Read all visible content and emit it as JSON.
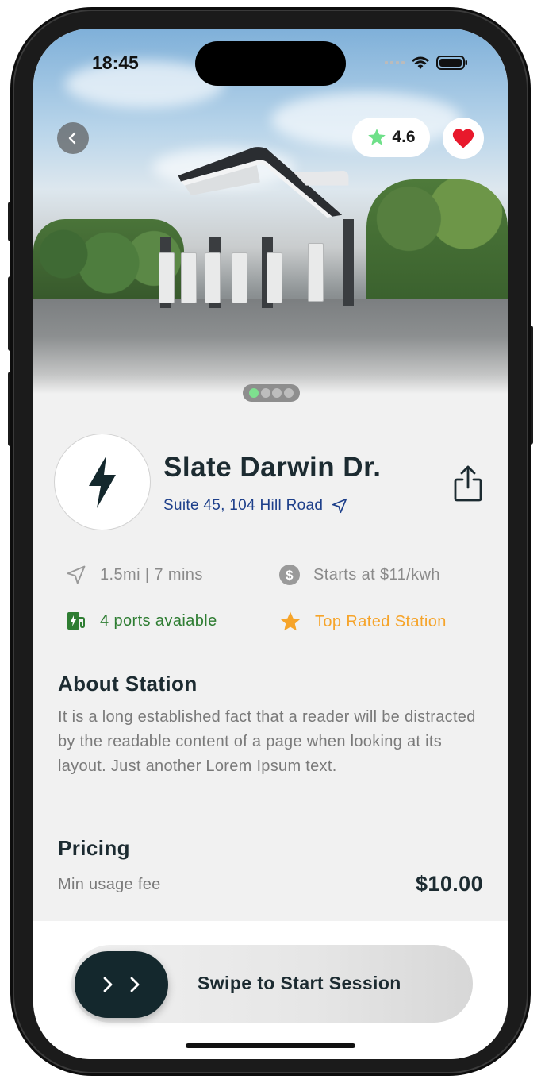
{
  "status_bar": {
    "time": "18:45"
  },
  "hero": {
    "rating": "4.6",
    "carousel": {
      "count": 4,
      "active": 0
    }
  },
  "station": {
    "name": "Slate Darwin Dr.",
    "address": "Suite 45, 104 Hill Road"
  },
  "info": {
    "distance": "1.5mi | 7 mins",
    "price": "Starts at $11/kwh",
    "ports": "4 ports avaiable",
    "badge": "Top Rated Station"
  },
  "about": {
    "title": "About Station",
    "text": "It is a long established fact that a reader will be distracted by the readable content of a page when looking at its layout. Just another Lorem Ipsum text."
  },
  "pricing": {
    "title": "Pricing",
    "label": "Min usage fee",
    "value": "$10.00"
  },
  "action": {
    "swipe_label": "Swipe to Start Session"
  },
  "colors": {
    "primary": "#14282d",
    "link": "#1d3f8a",
    "green": "#2e7d32",
    "accent_orange": "#f6a42a",
    "heart": "#e8192c",
    "rating_star": "#6fe089"
  },
  "icons": {
    "back": "chevron-left-icon",
    "rating": "star-icon",
    "favorite": "heart-icon",
    "logo": "lightning-bolt-icon",
    "share": "share-icon",
    "navigate": "navigation-arrow-icon",
    "price": "dollar-icon",
    "ports": "ev-charger-icon",
    "badge": "star-icon",
    "swipe": "double-chevron-right-icon"
  }
}
